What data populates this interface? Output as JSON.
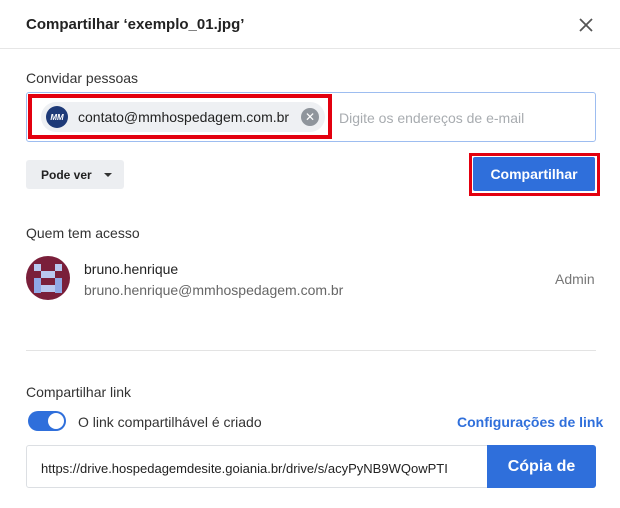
{
  "dialog": {
    "title": "Compartilhar ‘exemplo_01.jpg’",
    "close_icon": "close-icon"
  },
  "invite": {
    "label": "Convidar pessoas",
    "chip": {
      "avatar_text": "MM",
      "email": "contato@mmhospedagem.com.br",
      "remove_icon": "close-circle-icon"
    },
    "placeholder": "Digite os endereços de e-mail",
    "permission": "Pode ver",
    "share_button": "Compartilhar"
  },
  "access": {
    "label": "Quem tem acesso",
    "user": {
      "name": "bruno.henrique",
      "email": "bruno.henrique@mmhospedagem.com.br",
      "role": "Admin"
    }
  },
  "share_link": {
    "label": "Compartilhar link",
    "toggle_on": true,
    "toggle_label": "O link compartilhável é criado",
    "settings_link": "Configurações de link",
    "url": "https://drive.hospedagemdesite.goiania.br/drive/s/acyPyNB9WQowPTI",
    "copy_button": "Cópia de"
  },
  "colors": {
    "accent": "#2f6fdb",
    "highlight": "#e3000f",
    "avatar_brand": "#1e3a78"
  }
}
